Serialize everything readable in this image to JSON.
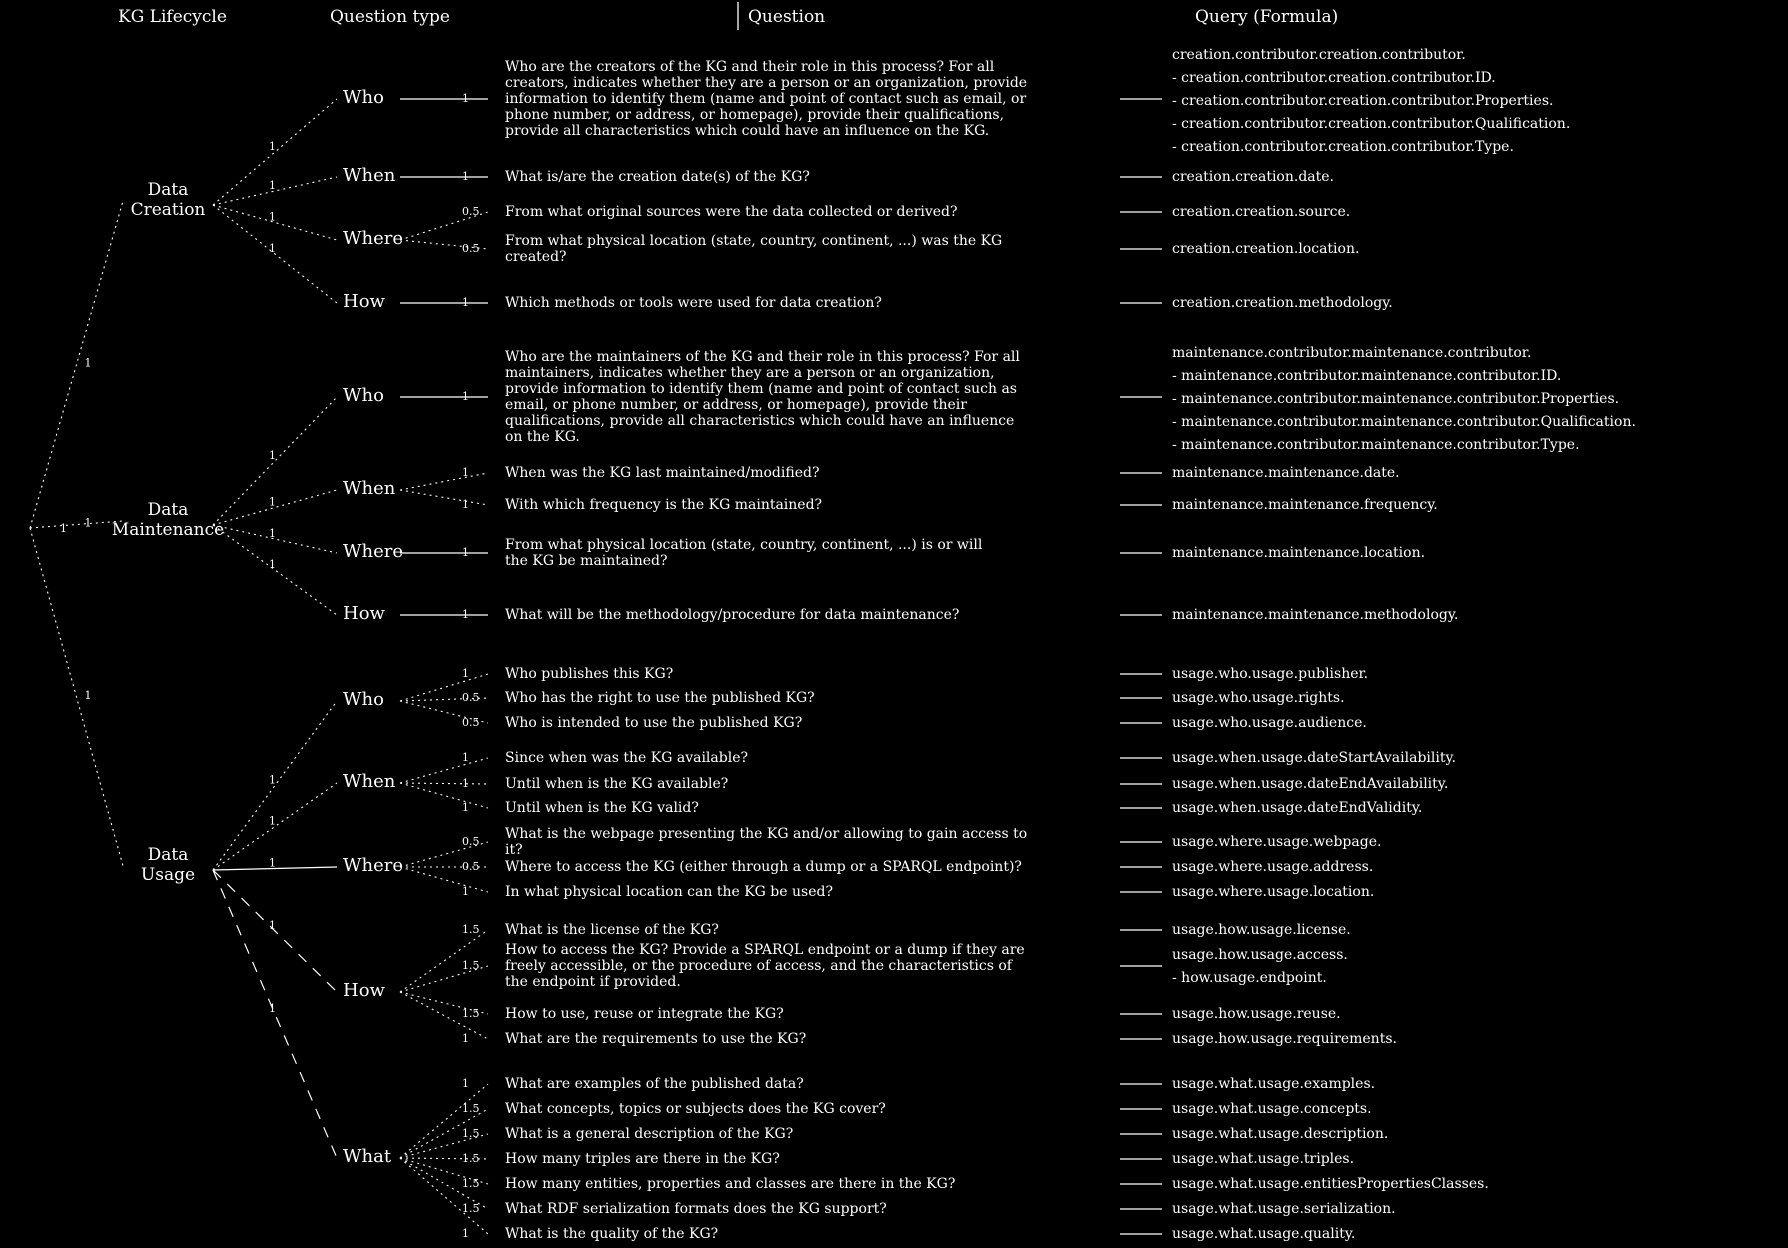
{
  "headers": {
    "lifecycle": "KG Lifecycle",
    "question_type": "Question type",
    "question": "Question",
    "query": "Query (Formula)"
  },
  "root_label": "1",
  "phases": {
    "creation": {
      "name": "Data\nCreation",
      "edge_label": "1",
      "types": [
        {
          "type": "Who",
          "edge": "1",
          "questions": [
            {
              "lbl": "1",
              "text": "Who are the creators of the KG and their role in this process? For all creators, indicates whether they are a person or an organization, provide information to identify them (name and point of contact such as email, or phone number, or address, or homepage), provide their qualifications, provide all characteristics which could have an influence on the KG.",
              "query": "creation.contributor.creation.contributor.\n- creation.contributor.creation.contributor.ID.\n- creation.contributor.creation.contributor.Properties.\n- creation.contributor.creation.contributor.Qualification.\n- creation.contributor.creation.contributor.Type."
            }
          ]
        },
        {
          "type": "When",
          "edge": "1",
          "questions": [
            {
              "lbl": "1",
              "text": "What is/are the creation date(s) of the KG?",
              "query": "creation.creation.date."
            }
          ]
        },
        {
          "type": "Where",
          "edge": "1",
          "questions": [
            {
              "lbl": "0.5",
              "text": "From what original sources were the data collected or derived?",
              "query": "creation.creation.source."
            },
            {
              "lbl": "0.5",
              "text": "From what physical location (state, country, continent, ...) was the KG created?",
              "query": "creation.creation.location."
            }
          ]
        },
        {
          "type": "How",
          "edge": "1",
          "questions": [
            {
              "lbl": "1",
              "text": "Which methods or tools were used for data creation?",
              "query": "creation.creation.methodology."
            }
          ]
        }
      ]
    },
    "maintenance": {
      "name": "Data\nMaintenance",
      "edge_label": "1",
      "types": [
        {
          "type": "Who",
          "edge": "1",
          "questions": [
            {
              "lbl": "1",
              "text": "Who are the maintainers of the KG and their role in this process? For all maintainers, indicates whether they are a person or an organization, provide information to identify them (name and point of contact such as email, or phone number, or address, or homepage), provide their qualifications, provide all characteristics which could have an influence on the KG.",
              "query": "maintenance.contributor.maintenance.contributor.\n- maintenance.contributor.maintenance.contributor.ID.\n- maintenance.contributor.maintenance.contributor.Properties.\n- maintenance.contributor.maintenance.contributor.Qualification.\n- maintenance.contributor.maintenance.contributor.Type."
            }
          ]
        },
        {
          "type": "When",
          "edge": "1",
          "questions": [
            {
              "lbl": "1",
              "text": "When was the KG last maintained/modified?",
              "query": "maintenance.maintenance.date."
            },
            {
              "lbl": "1",
              "text": "With which frequency is the KG maintained?",
              "query": "maintenance.maintenance.frequency."
            }
          ]
        },
        {
          "type": "Where",
          "edge": "1",
          "questions": [
            {
              "lbl": "1",
              "text": "From what physical location (state, country, continent, ...) is or will the KG be maintained?",
              "query": "maintenance.maintenance.location."
            }
          ]
        },
        {
          "type": "How",
          "edge": "1",
          "questions": [
            {
              "lbl": "1",
              "text": "What will be the methodology/procedure for data maintenance?",
              "query": "maintenance.maintenance.methodology."
            }
          ]
        }
      ]
    },
    "usage": {
      "name": "Data\nUsage",
      "edge_label": "1",
      "types": [
        {
          "type": "Who",
          "edge": "1",
          "questions": [
            {
              "lbl": "1",
              "text": "Who publishes this KG?",
              "query": "usage.who.usage.publisher."
            },
            {
              "lbl": "0.5",
              "text": "Who has the right to use the published KG?",
              "query": "usage.who.usage.rights."
            },
            {
              "lbl": "0.5",
              "text": "Who is intended to use the published KG?",
              "query": "usage.who.usage.audience."
            }
          ]
        },
        {
          "type": "When",
          "edge": "1",
          "questions": [
            {
              "lbl": "1",
              "text": "Since when was the KG available?",
              "query": "usage.when.usage.dateStartAvailability."
            },
            {
              "lbl": "1",
              "text": "Until when is the KG available?",
              "query": "usage.when.usage.dateEndAvailability."
            },
            {
              "lbl": "1",
              "text": "Until when is the KG valid?",
              "query": "usage.when.usage.dateEndValidity."
            }
          ]
        },
        {
          "type": "Where",
          "edge": "1",
          "questions": [
            {
              "lbl": "0.5",
              "text": "What is the webpage presenting the KG and/or allowing to gain access to it?",
              "query": "usage.where.usage.webpage."
            },
            {
              "lbl": "0.5",
              "text": "Where to access the KG (either through a dump or a SPARQL endpoint)?",
              "query": "usage.where.usage.address."
            },
            {
              "lbl": "1",
              "text": "In what physical location can the KG be used?",
              "query": "usage.where.usage.location."
            }
          ]
        },
        {
          "type": "How",
          "edge": "1",
          "questions": [
            {
              "lbl": "1.5",
              "text": "What is the license of the KG?",
              "query": "usage.how.usage.license."
            },
            {
              "lbl": "1.5",
              "text": "How to access the KG? Provide a SPARQL endpoint or a dump if they are freely accessible, or the procedure of access, and the characteristics of the endpoint if provided.",
              "query": "usage.how.usage.access.\n- how.usage.endpoint."
            },
            {
              "lbl": "1.5",
              "text": "How to use, reuse or integrate the KG?",
              "query": "usage.how.usage.reuse."
            },
            {
              "lbl": "1",
              "text": "What are the requirements to use the KG?",
              "query": "usage.how.usage.requirements."
            }
          ]
        },
        {
          "type": "What",
          "edge": "1",
          "questions": [
            {
              "lbl": "1",
              "text": "What are examples of the published data?",
              "query": "usage.what.usage.examples."
            },
            {
              "lbl": "1.5",
              "text": "What concepts, topics or subjects does the KG cover?",
              "query": "usage.what.usage.concepts."
            },
            {
              "lbl": "1.5",
              "text": "What is a general description of the KG?",
              "query": "usage.what.usage.description."
            },
            {
              "lbl": "1.5",
              "text": "How many triples are there in the KG?",
              "query": "usage.what.usage.triples."
            },
            {
              "lbl": "1.5",
              "text": "How many entities, properties and classes are there in the KG?",
              "query": "usage.what.usage.entitiesPropertiesClasses."
            },
            {
              "lbl": "1.5",
              "text": "What RDF serialization formats does the KG support?",
              "query": "usage.what.usage.serialization."
            },
            {
              "lbl": "1",
              "text": "What is the quality of the KG?",
              "query": "usage.what.usage.quality."
            }
          ]
        }
      ]
    }
  }
}
